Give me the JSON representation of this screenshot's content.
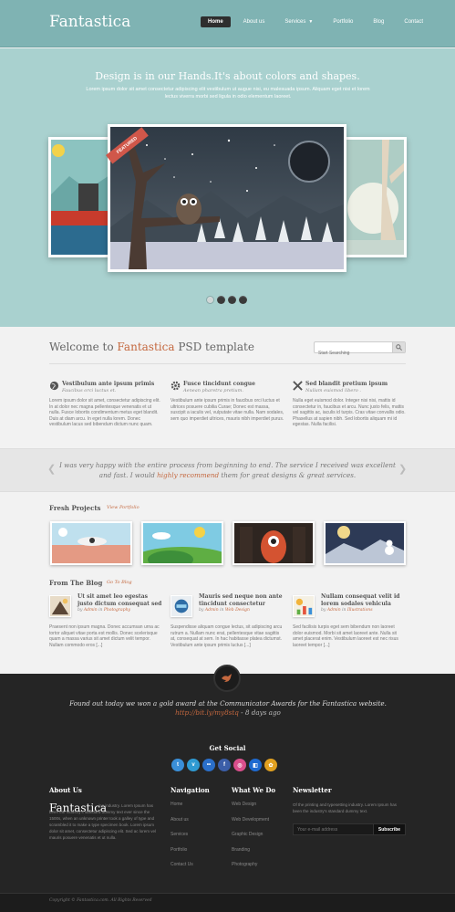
{
  "header": {
    "logo": "Fantastica",
    "nav": [
      {
        "label": "Home",
        "active": true
      },
      {
        "label": "About us"
      },
      {
        "label": "Services",
        "dropdown": true
      },
      {
        "label": "Portfolio"
      },
      {
        "label": "Blog"
      },
      {
        "label": "Contact"
      }
    ]
  },
  "hero": {
    "title": "Design is in our Hands.It's about colors and shapes.",
    "subtitle": "Lorem ipsum dolor sit amet consectetur adipiscing elit vestibulum ut augue nisi, eu malesuada ipsum. Aliquam eget nisi et lorem lectus viverra morbi sed ligula in odio elementum laoreet.",
    "ribbon": "FEATURED",
    "pager": {
      "count": 4,
      "active": 1
    }
  },
  "welcome": {
    "prefix": "Welcome to",
    "brand": "Fantastica",
    "suffix": "PSD template",
    "search_placeholder": "Start Searching"
  },
  "features": [
    {
      "icon": "globe-icon",
      "title": "Vestibulum ante ipsum primis",
      "subtitle": "Faucibus orci luctus et.",
      "text": "Lorem ipsum dolor sit amet, consectetur adipiscing elit. In at dolor nec magna pellentesque venenatis et ut nulla. Fusce lobortis condimentum metus eget blandit. Duis at diam arcu. In eget nulla lorem. Donec vestibulum lacus sed bibendum dictum nunc quam."
    },
    {
      "icon": "gear-icon",
      "title": "Fusce tincidunt congue",
      "subtitle": "Aenean pharetra pretium.",
      "text": "Vestibulum ante ipsum primis in faucibus orci luctus et ultrices posuere cubilia Curae; Donec est massa, suscipit a iaculis vel, vulputate vitae nulla. Nam sodales, sem quo imperdiet ultrices, mauris nibh imperdiet purus."
    },
    {
      "icon": "tools-icon",
      "title": "Sed blandit pretium ipsum",
      "subtitle": "Nullam euismod libero .",
      "text": "Nulla eget euismod dolor. Integer nisi nisi, mattis id consectetur in, faucibus et arcu. Nunc justo felis, mattis vel sagittis ac, iaculis id turpis. Cras vitae convallis odio. Phasellus at sapien nibh. Sed lobortis aliquam mi id egestas. Nulla facilisi."
    }
  ],
  "testimonial": {
    "before": "I was very happy with the entire process from beginning to end. The service I received was excellent and fast. I would",
    "highlight": "highly recommend",
    "after": "them for great designs & great services."
  },
  "projects": {
    "heading": "Fresh Projects",
    "link": "View Portfolio"
  },
  "blog": {
    "heading": "From The Blog",
    "link": "Go To Blog",
    "posts": [
      {
        "title": "Ut sit amet leo egestas justo dictum consequat sed",
        "meta_prefix": "by",
        "author": "Admin",
        "meta_mid": "in",
        "category": "Photography",
        "text": "Praesent non ipsum magna. Donec accumsan urna ac tortor aliquet vitae porta est mollis. Donec scelerisque quam a massa varius sit amet dictum velit tempor. Nullam commodo eros [...]"
      },
      {
        "title": "Mauris sed neque non ante tincidunt consectetur",
        "meta_prefix": "by",
        "author": "Admin",
        "meta_mid": "in",
        "category": "Web Design",
        "text": "Suspendisse aliquam congue lectus, sit adipiscing arcu rutrum a. Nullam nunc erat, pellentesque vitae sagittis at, consequat at sem. In hac habitasse platea dictumst. Vestibulum ante ipsum primis luctus [...]"
      },
      {
        "title": "Nullam consequat velit id lorem sodales vehicula",
        "meta_prefix": "by",
        "author": "Admin",
        "meta_mid": "in",
        "category": "Illustrations",
        "text": "Sed facilisis turpis eget sem bibendum non laoreet dolor euismod. Morbi sit amet laoreet ante. Nulla sit amet placerat enim. Vestibulum laoreet est nec risus laoreet tempor [...]"
      }
    ]
  },
  "footer": {
    "tweet": {
      "text": "Found out today we won a gold award at the Communicator Awards for the Fantastica website.",
      "link": "http://bit.ly/my8stq",
      "time": "8 days ago"
    },
    "social_heading": "Get Social",
    "socials": [
      {
        "icon": "twitter-icon",
        "glyph": "t",
        "color": "#3a8fd8"
      },
      {
        "icon": "vimeo-icon",
        "glyph": "v",
        "color": "#2f9ad2"
      },
      {
        "icon": "flickr-icon",
        "glyph": "••",
        "color": "#2b6fc9"
      },
      {
        "icon": "facebook-icon",
        "glyph": "f",
        "color": "#3b5ea8"
      },
      {
        "icon": "dribbble-icon",
        "glyph": "◎",
        "color": "#d94f8c"
      },
      {
        "icon": "delicious-icon",
        "glyph": "◧",
        "color": "#1e6ad0"
      },
      {
        "icon": "picasa-icon",
        "glyph": "✿",
        "color": "#e0a020"
      }
    ],
    "about": {
      "heading": "About Us",
      "logo": "Fantastica",
      "text": "ing industry. Lorem Ipsum has been the industry's standard dummy text ever since the 1500s, when an unknown printer took a galley of type and scrambled it to make a type specimen book. Lorem ipsum dolor sit amet, consectetur adipiscing elit. Sed ac lorem vel mauris posuere venenatis et ut nulla."
    },
    "navigation": {
      "heading": "Navigation",
      "items": [
        "Home",
        "About us",
        "Services",
        "Portfolio",
        "Contact Us"
      ]
    },
    "whatwedo": {
      "heading": "What We Do",
      "items": [
        "Web Design",
        "Web Development",
        "Graphic Design",
        "Branding",
        "Photography"
      ]
    },
    "newsletter": {
      "heading": "Newsletter",
      "text": "Of the printing and typesetting industry. Lorem Ipsum has been the industry's standard dummy text.",
      "placeholder": "Your e-mail address",
      "button": "Subscribe"
    },
    "copyright": "Copyright © Fantastica.com. All Rights Reserved"
  },
  "colors": {
    "accent": "#c4683f",
    "hero": "#a9d1cf",
    "header": "#7fb3b3",
    "footer": "#252525"
  }
}
